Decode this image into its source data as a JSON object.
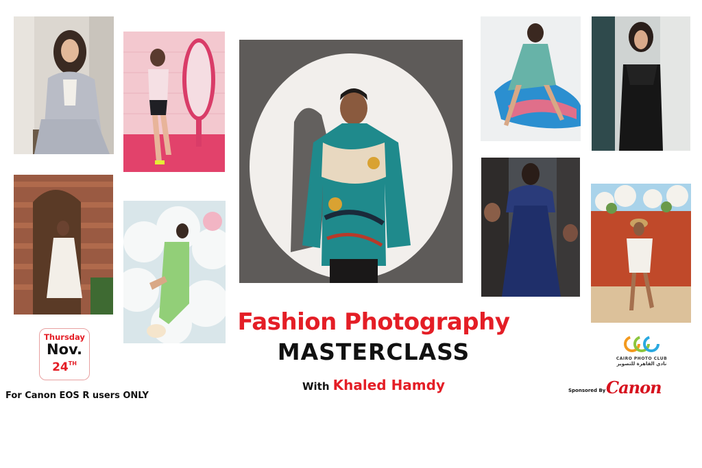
{
  "event": {
    "title_line1": "Fashion Photography",
    "title_line2": "MASTERCLASS",
    "with_prefix": "With",
    "instructor": "Khaled Hamdy"
  },
  "date": {
    "day": "Thursday",
    "month": "Nov.",
    "number": "24",
    "suffix": "TH"
  },
  "audience": "For Canon EOS R users ONLY",
  "organizer": {
    "logo_mark": "CPC",
    "name": "CAIRO PHOTO CLUB",
    "name_arabic": "نادي القاهرة للتصوير"
  },
  "sponsor": {
    "label": "Sponsored By",
    "logo_text": "Canon"
  },
  "colors": {
    "accent_red": "#e41e26",
    "canon_red": "#d7121e",
    "text_black": "#111111",
    "background": "#ffffff"
  },
  "photos": [
    {
      "id": "woman-grey-suit"
    },
    {
      "id": "woman-pink-mirror"
    },
    {
      "id": "man-spotlight-patterned-shirt"
    },
    {
      "id": "woman-teal-dress-blue-chair"
    },
    {
      "id": "woman-black-jumpsuit"
    },
    {
      "id": "woman-white-dress-wooden-door"
    },
    {
      "id": "woman-green-dress-clouds"
    },
    {
      "id": "woman-blue-gown-crowd"
    },
    {
      "id": "woman-white-outfit-red-wall"
    }
  ]
}
